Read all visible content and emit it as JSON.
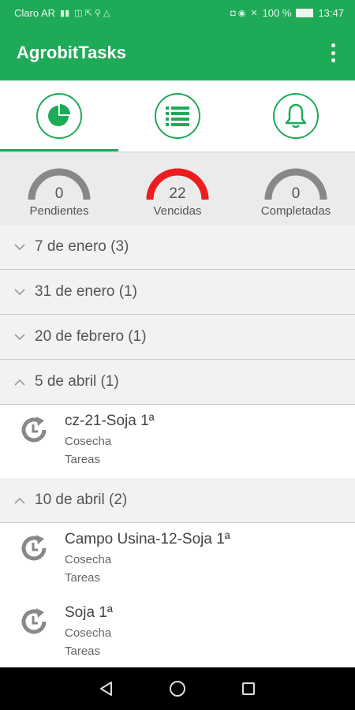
{
  "status": {
    "carrier": "Claro AR",
    "battery": "100 %",
    "time": "13:47"
  },
  "app": {
    "title": "AgrobitTasks"
  },
  "tabs": [
    {
      "icon": "pie-chart-icon",
      "active": true
    },
    {
      "icon": "list-icon",
      "active": false
    },
    {
      "icon": "bell-icon",
      "active": false
    }
  ],
  "gauges": [
    {
      "value": "0",
      "label": "Pendientes",
      "fraction": 0,
      "color": "#888888"
    },
    {
      "value": "22",
      "label": "Vencidas",
      "fraction": 1,
      "color": "#ee1c1c"
    },
    {
      "value": "0",
      "label": "Completadas",
      "fraction": 0,
      "color": "#888888"
    }
  ],
  "sections": [
    {
      "title": "7 de enero (3)",
      "expanded": false,
      "items": []
    },
    {
      "title": "31 de enero (1)",
      "expanded": false,
      "items": []
    },
    {
      "title": "20 de febrero (1)",
      "expanded": false,
      "items": []
    },
    {
      "title": "5 de abril (1)",
      "expanded": true,
      "items": [
        {
          "title": "cz-21-Soja 1ª",
          "subtitle": "Cosecha",
          "type": "Tareas"
        }
      ]
    },
    {
      "title": "10 de abril (2)",
      "expanded": true,
      "items": [
        {
          "title": "Campo Usina-12-Soja 1ª",
          "subtitle": "Cosecha",
          "type": "Tareas"
        },
        {
          "title": "Soja 1ª",
          "subtitle": "Cosecha",
          "type": "Tareas"
        }
      ]
    }
  ],
  "colors": {
    "primary": "#1faa58",
    "overdue": "#ee1c1c",
    "gauge_track": "#888888"
  }
}
